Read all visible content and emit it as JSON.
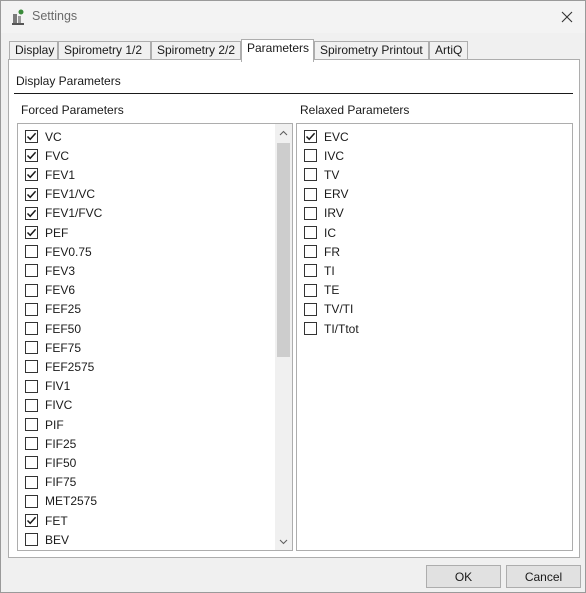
{
  "window": {
    "title": "Settings"
  },
  "tabs": [
    {
      "label": "Display",
      "active": false
    },
    {
      "label": "Spirometry 1/2",
      "active": false
    },
    {
      "label": "Spirometry 2/2",
      "active": false
    },
    {
      "label": "Parameters",
      "active": true
    },
    {
      "label": "Spirometry Printout",
      "active": false
    },
    {
      "label": "ArtiQ",
      "active": false
    }
  ],
  "panel": {
    "section_title": "Display Parameters",
    "forced": {
      "label": "Forced Parameters",
      "items": [
        {
          "label": "VC",
          "checked": true
        },
        {
          "label": "FVC",
          "checked": true
        },
        {
          "label": "FEV1",
          "checked": true
        },
        {
          "label": "FEV1/VC",
          "checked": true
        },
        {
          "label": "FEV1/FVC",
          "checked": true
        },
        {
          "label": "PEF",
          "checked": true
        },
        {
          "label": "FEV0.75",
          "checked": false
        },
        {
          "label": "FEV3",
          "checked": false
        },
        {
          "label": "FEV6",
          "checked": false
        },
        {
          "label": "FEF25",
          "checked": false
        },
        {
          "label": "FEF50",
          "checked": false
        },
        {
          "label": "FEF75",
          "checked": false
        },
        {
          "label": "FEF2575",
          "checked": false
        },
        {
          "label": "FIV1",
          "checked": false
        },
        {
          "label": "FIVC",
          "checked": false
        },
        {
          "label": "PIF",
          "checked": false
        },
        {
          "label": "FIF25",
          "checked": false
        },
        {
          "label": "FIF50",
          "checked": false
        },
        {
          "label": "FIF75",
          "checked": false
        },
        {
          "label": "MET2575",
          "checked": false
        },
        {
          "label": "FET",
          "checked": true
        },
        {
          "label": "BEV",
          "checked": false
        }
      ]
    },
    "relaxed": {
      "label": "Relaxed Parameters",
      "items": [
        {
          "label": "EVC",
          "checked": true
        },
        {
          "label": "IVC",
          "checked": false
        },
        {
          "label": "TV",
          "checked": false
        },
        {
          "label": "ERV",
          "checked": false
        },
        {
          "label": "IRV",
          "checked": false
        },
        {
          "label": "IC",
          "checked": false
        },
        {
          "label": "FR",
          "checked": false
        },
        {
          "label": "TI",
          "checked": false
        },
        {
          "label": "TE",
          "checked": false
        },
        {
          "label": "TV/TI",
          "checked": false
        },
        {
          "label": "TI/Ttot",
          "checked": false
        }
      ]
    }
  },
  "buttons": {
    "ok": "OK",
    "cancel": "Cancel"
  },
  "icons": {
    "app": "settings-app-icon",
    "close": "close-icon",
    "check": "checkmark-icon",
    "scroll_up": "chevron-up-icon",
    "scroll_down": "chevron-down-icon"
  }
}
